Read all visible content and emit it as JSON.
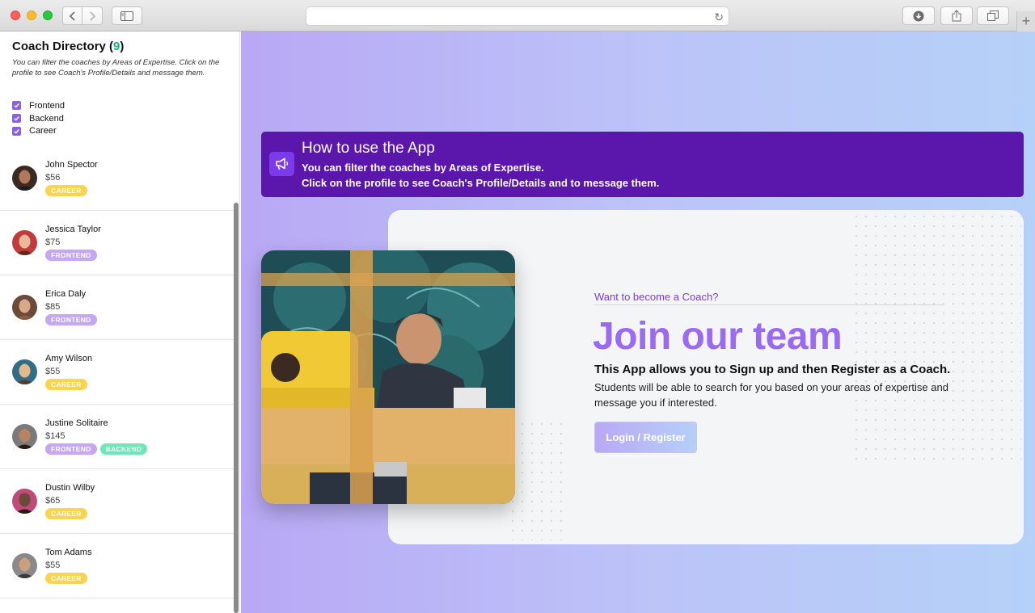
{
  "browser": {
    "address_value": "",
    "new_tab_symbol": "+"
  },
  "directory": {
    "title": "Coach Directory (",
    "count": "9",
    "title_end": ")",
    "description": "You can filter the coaches by Areas of Expertise. Click on the profile to see Coach's Profile/Details and message them.",
    "filters": [
      {
        "label": "Frontend",
        "checked": true
      },
      {
        "label": "Backend",
        "checked": true
      },
      {
        "label": "Career",
        "checked": true
      }
    ],
    "coaches": [
      {
        "name": "John Spector",
        "rate": "$56",
        "tags": [
          "CAREER"
        ]
      },
      {
        "name": "Jessica Taylor",
        "rate": "$75",
        "tags": [
          "FRONTEND"
        ]
      },
      {
        "name": "Erica Daly",
        "rate": "$85",
        "tags": [
          "FRONTEND"
        ]
      },
      {
        "name": "Amy Wilson",
        "rate": "$55",
        "tags": [
          "CAREER"
        ]
      },
      {
        "name": "Justine Solitaire",
        "rate": "$145",
        "tags": [
          "FRONTEND",
          "BACKEND"
        ]
      },
      {
        "name": "Dustin Wilby",
        "rate": "$65",
        "tags": [
          "CAREER"
        ]
      },
      {
        "name": "Tom Adams",
        "rate": "$55",
        "tags": [
          "CAREER"
        ]
      }
    ],
    "tag_colors": {
      "CAREER": "#fcd34d",
      "FRONTEND": "#c4a6f5",
      "BACKEND": "#6ee7b7"
    }
  },
  "banner": {
    "title": "How to use the App",
    "line1": "You can filter the coaches by Areas of Expertise.",
    "line2": "Click on the profile to see Coach's Profile/Details and to message them.",
    "icon": "megaphone-icon"
  },
  "cta": {
    "eyebrow": "Want to become a Coach?",
    "title": "Join our team",
    "subtitle": "This App allows you to Sign up and then Register as a Coach.",
    "text": "Students will be able to search for you based on your areas of expertise and message you if interested.",
    "button": "Login / Register"
  },
  "colors": {
    "accent": "#8b5cf6",
    "banner_bg": "#5b16ab",
    "count_green": "#10b981"
  }
}
